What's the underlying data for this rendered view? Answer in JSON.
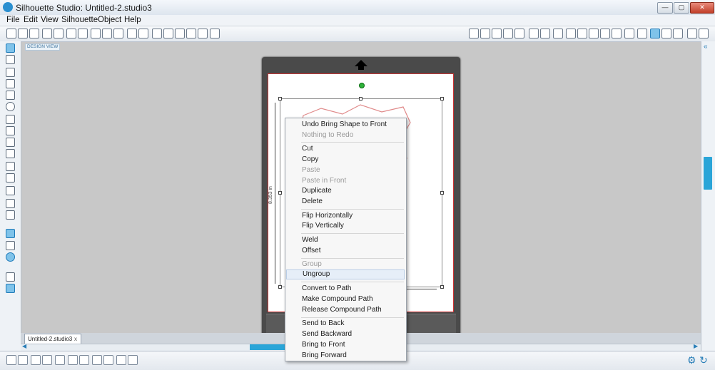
{
  "window": {
    "title": "Silhouette Studio: Untitled-2.studio3",
    "minimize_label": "—",
    "maximize_label": "▢",
    "close_label": "✕"
  },
  "menubar": {
    "items": [
      "File",
      "Edit",
      "View",
      "Silhouette",
      "Object",
      "Help"
    ]
  },
  "design_view_label": "DESIGN VIEW",
  "document": {
    "tab_name": "Untitled-2.studio3",
    "tab_close": "x",
    "height_dimension": "8.353 in"
  },
  "context_menu": {
    "items": [
      {
        "label": "Undo Bring Shape to Front",
        "enabled": true
      },
      {
        "label": "Nothing to Redo",
        "enabled": false
      },
      {
        "label": "Cut",
        "enabled": true
      },
      {
        "label": "Copy",
        "enabled": true
      },
      {
        "label": "Paste",
        "enabled": false
      },
      {
        "label": "Paste in Front",
        "enabled": false
      },
      {
        "label": "Duplicate",
        "enabled": true
      },
      {
        "label": "Delete",
        "enabled": true
      },
      {
        "label": "Flip Horizontally",
        "enabled": true
      },
      {
        "label": "Flip Vertically",
        "enabled": true
      },
      {
        "label": "Weld",
        "enabled": true
      },
      {
        "label": "Offset",
        "enabled": true
      },
      {
        "label": "Group",
        "enabled": false
      },
      {
        "label": "Ungroup",
        "enabled": true,
        "hovered": true
      },
      {
        "label": "Convert to Path",
        "enabled": true
      },
      {
        "label": "Make Compound Path",
        "enabled": true
      },
      {
        "label": "Release Compound Path",
        "enabled": true
      },
      {
        "label": "Send to Back",
        "enabled": true
      },
      {
        "label": "Send Backward",
        "enabled": true
      },
      {
        "label": "Bring to Front",
        "enabled": true
      },
      {
        "label": "Bring Forward",
        "enabled": true
      }
    ]
  },
  "colors": {
    "accent": "#2aa5d8",
    "artwork_outline": "#e08a8a",
    "paper_border": "#cc3333",
    "mat": "#4a4a4a"
  }
}
